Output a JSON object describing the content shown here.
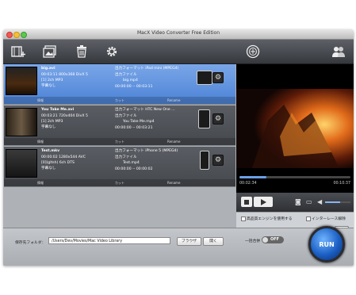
{
  "window": {
    "title": "MacX Video Converter Free Edition"
  },
  "toolbar": {
    "add_video": "add-video-icon",
    "add_photo": "add-photo-icon",
    "delete": "trash-icon",
    "settings": "gear-icon",
    "update": "update-icon",
    "account": "people-icon"
  },
  "files": [
    {
      "name": "big.avi",
      "info1": "00:03:11 800x368 DivX 5",
      "audio": "[1] 2ch MP3",
      "subtitle": "字幕なし",
      "output_format": "出力フォーマット iPad mini (MPEG4)",
      "output_file_label": "出力ファイル",
      "output_file": "big.mp4",
      "output_time": "00:00:00 -- 00:03:11",
      "selected": true
    },
    {
      "name": "You Take Me.avi",
      "info1": "00:03:21 720x404 DivX 5",
      "audio": "[1] 2ch MP3",
      "subtitle": "字幕なし",
      "output_format": "出力フォーマット HTC New One ...",
      "output_file_label": "出力ファイル",
      "output_file": "You Take Me.mp4",
      "output_time": "00:00:00 -- 00:03:21",
      "selected": false
    },
    {
      "name": "Test.mkv",
      "info1": "00:00:02 1280x544 AVC",
      "audio": "[0](gltsh) 6ch DTS",
      "subtitle": "字幕なし",
      "output_format": "出力フォーマット iPhone 5 (MPEG4)",
      "output_file_label": "出力ファイル",
      "output_file": "Test.mp4",
      "output_time": "00:00:00 -- 00:00:02",
      "selected": false
    }
  ],
  "row_buttons": {
    "info": "情報",
    "cut": "カット",
    "rename": "Rename"
  },
  "player": {
    "time_current": "00:02:34",
    "time_total": "00:10:37",
    "progress": 0.24,
    "volume": 0.6
  },
  "options": {
    "hq_engine": "高品質エンジンを使用する",
    "deinterlace": "インターレース解除",
    "safe_mode": "安全モード",
    "cpu_label": "CPUコア使用：",
    "cpu_value": "2",
    "merge_label": "一括合併",
    "merge_state": "OFF"
  },
  "bottom": {
    "folder_label": "保存先フォルダ：",
    "folder_path": "/Users/Dev/Movies/Mac Video Library",
    "browse": "ブラウザ",
    "open": "開く",
    "run": "RUN"
  }
}
